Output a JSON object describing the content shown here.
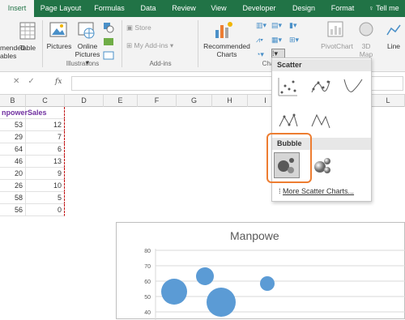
{
  "tabs": [
    "Insert",
    "Page Layout",
    "Formulas",
    "Data",
    "Review",
    "View",
    "Developer",
    "Design",
    "Format"
  ],
  "active_tab": "Insert",
  "tell_me": "Tell me",
  "ribbon": {
    "tables": {
      "partial_top": "mended",
      "partial_bottom": "ables",
      "table": "Table"
    },
    "illustrations": {
      "pictures": "Pictures",
      "online": "Online",
      "pictures2": "Pictures",
      "group_label": "Illustrations"
    },
    "addins": {
      "store": "Store",
      "my_addins": "My Add-ins",
      "group_label": "Add-ins"
    },
    "charts": {
      "recommended1": "Recommended",
      "recommended2": "Charts",
      "group_label": "Cha",
      "pivotchart": "PivotChart",
      "map1": "3D",
      "map2": "Map",
      "line": "Line"
    }
  },
  "formula_bar": {
    "name_box": "",
    "value": ""
  },
  "columns": [
    "B",
    "C",
    "D",
    "E",
    "F",
    "G",
    "H",
    "I",
    "L"
  ],
  "sheet": {
    "header_b": "npower",
    "header_c": "Sales",
    "rows": [
      {
        "b": "53",
        "c": "12"
      },
      {
        "b": "29",
        "c": "7"
      },
      {
        "b": "64",
        "c": "6"
      },
      {
        "b": "46",
        "c": "13"
      },
      {
        "b": "20",
        "c": "9"
      },
      {
        "b": "26",
        "c": "10"
      },
      {
        "b": "58",
        "c": "5"
      },
      {
        "b": "56",
        "c": "0"
      }
    ]
  },
  "chart": {
    "title": "Manpowe",
    "y_ticks": [
      "80",
      "70",
      "60",
      "50",
      "40"
    ]
  },
  "dropdown": {
    "scatter_label": "Scatter",
    "bubble_label": "Bubble",
    "more": "More Scatter Charts..."
  },
  "colors": {
    "excel_green": "#217346",
    "bubble": "#5b9bd5",
    "highlight": "#ed7d31"
  }
}
